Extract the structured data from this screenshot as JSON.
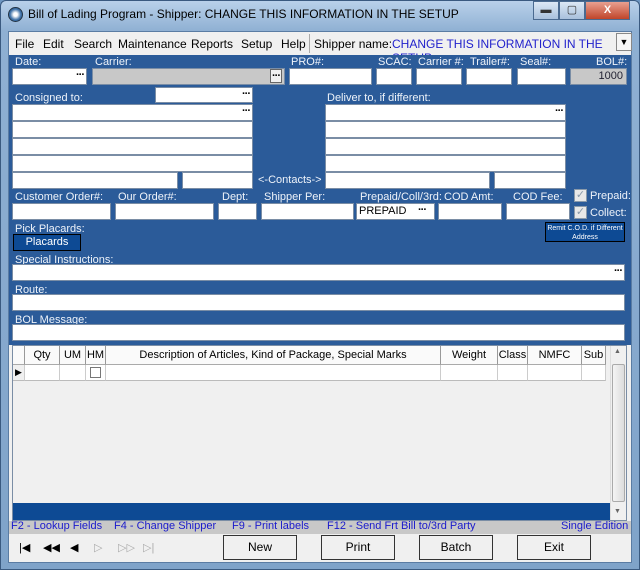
{
  "window": {
    "title": "Bill of Lading Program - Shipper: CHANGE THIS INFORMATION IN THE SETUP",
    "minimize": "▬",
    "maximize": "▢",
    "close": "X"
  },
  "menu": {
    "items": [
      "File",
      "Edit",
      "Search",
      "Maintenance",
      "Reports",
      "Setup",
      "Help"
    ],
    "shipper_label": "Shipper name:",
    "shipper_value": "CHANGE THIS INFORMATION IN THE SETUP"
  },
  "header": {
    "date": "Date:",
    "carrier": "Carrier:",
    "pro": "PRO#:",
    "scac": "SCAC:",
    "carrier_no": "Carrier #:",
    "trailer": "Trailer#:",
    "seal": "Seal#:",
    "bol": "BOL#:",
    "bol_value": "1000"
  },
  "address": {
    "consigned": "Consigned to:",
    "deliver": "Deliver to, if different:",
    "contacts": "<-Contacts->"
  },
  "order": {
    "customer_order": "Customer Order#:",
    "our_order": "Our Order#:",
    "dept": "Dept:",
    "shipper_per": "Shipper Per:",
    "prepaid_coll": "Prepaid/Coll/3rd:",
    "prepaid_value": "PREPAID",
    "cod_amt": "COD Amt:",
    "cod_fee": "COD Fee:",
    "prepaid_cb": "Prepaid:",
    "collect_cb": "Collect:"
  },
  "placards": {
    "label": "Pick Placards:",
    "button": "Placards",
    "remit": "Remit C.O.D. if Different Address"
  },
  "fields": {
    "special": "Special Instructions:",
    "route": "Route:",
    "bol_message": "BOL Message:"
  },
  "grid": {
    "columns": [
      "Qty",
      "UM",
      "HM",
      "Description of Articles, Kind of Package, Special Marks",
      "Weight",
      "Class",
      "NMFC",
      "Sub"
    ]
  },
  "status": {
    "f2": "F2 - Lookup Fields",
    "f4": "F4 - Change Shipper",
    "f9": "F9 - Print labels",
    "f12": "F12 - Send Frt Bill to/3rd Party",
    "edition": "Single Edition"
  },
  "buttons": {
    "new": "New",
    "print": "Print",
    "batch": "Batch",
    "exit": "Exit"
  },
  "dots": "···",
  "colors": {
    "form_bg": "#2b5b99",
    "accent": "#0d4a94",
    "status_text": "#1a1acc"
  }
}
